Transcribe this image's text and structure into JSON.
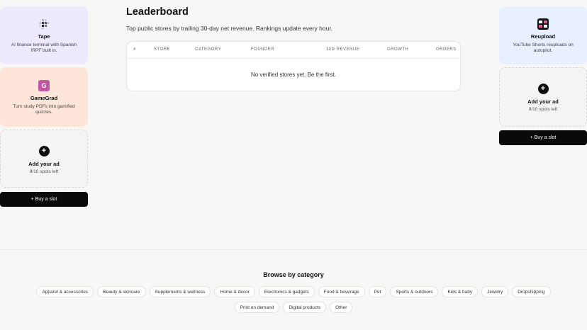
{
  "left_ads": [
    {
      "title": "Tape",
      "description": "AI finance terminal with Spanish IRPF built in.",
      "bg": "#efe9ff",
      "icon": "grid-icon"
    },
    {
      "title": "GameGrad",
      "description": "Turn study PDFs into gamified quizzes.",
      "bg": "#fde5d9",
      "icon_letter": "G",
      "icon_color": "#c2569f"
    }
  ],
  "left_slot": {
    "title": "Add your ad",
    "count": "8/10 spots left",
    "plus": "+"
  },
  "left_buy": "+ Buy a slot",
  "right_ads": [
    {
      "title": "Reupload",
      "description": "YouTube Shorts reuploads on autopilot.",
      "bg": "#e8efff",
      "icon": "reupload-logo-icon"
    }
  ],
  "right_slot": {
    "title": "Add your ad",
    "count": "9/10 spots left",
    "plus": "+"
  },
  "right_buy": "+ Buy a slot",
  "main": {
    "title": "Leaderboard",
    "subtitle": "Top public stores by trailing 30-day net revenue. Rankings update every hour.",
    "columns": [
      "#",
      "STORE",
      "CATEGORY",
      "FOUNDER",
      "30D REVENUE",
      "GROWTH",
      "ORDERS"
    ],
    "empty_message": "No verified stores yet. Be the first."
  },
  "browse": {
    "title": "Browse by category",
    "row1": [
      "Apparel & accessories",
      "Beauty & skincare",
      "Supplements & wellness",
      "Home & decor",
      "Electronics & gadgets",
      "Food & beverage",
      "Pet",
      "Sports & outdoors",
      "Kids & baby",
      "Jewelry",
      "Dropshipping"
    ],
    "row2": [
      "Print on demand",
      "Digital products",
      "Other"
    ]
  }
}
